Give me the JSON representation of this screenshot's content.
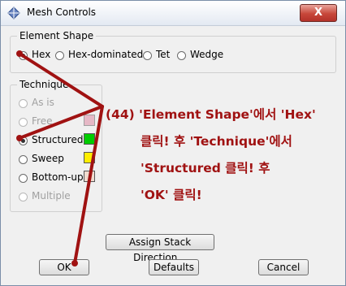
{
  "window": {
    "title": "Mesh Controls",
    "close_label": "X"
  },
  "element_shape": {
    "label": "Element Shape",
    "options": [
      {
        "label": "Hex",
        "selected": true
      },
      {
        "label": "Hex-dominated",
        "selected": false
      },
      {
        "label": "Tet",
        "selected": false
      },
      {
        "label": "Wedge",
        "selected": false
      }
    ]
  },
  "technique": {
    "label": "Technique",
    "options": [
      {
        "label": "As is",
        "enabled": false,
        "selected": false,
        "swatch": null
      },
      {
        "label": "Free",
        "enabled": false,
        "selected": false,
        "swatch": "#e6b8c6"
      },
      {
        "label": "Structured",
        "enabled": true,
        "selected": true,
        "swatch": "#00cc00"
      },
      {
        "label": "Sweep",
        "enabled": true,
        "selected": false,
        "swatch": "#ffee00"
      },
      {
        "label": "Bottom-up",
        "enabled": true,
        "selected": false,
        "swatch": "#f0dcd0"
      },
      {
        "label": "Multiple",
        "enabled": false,
        "selected": false,
        "swatch": null
      }
    ]
  },
  "buttons": {
    "assign_stack": "Assign Stack Direction...",
    "ok": "OK",
    "defaults": "Defaults",
    "cancel": "Cancel"
  },
  "annotation": {
    "line1": "(44)  'Element Shape'에서  'Hex'",
    "line2": "클릭! 후  'Technique'에서",
    "line3": "'Structured 클릭! 후",
    "line4": "'OK' 클릭!",
    "color": "#a01212"
  }
}
